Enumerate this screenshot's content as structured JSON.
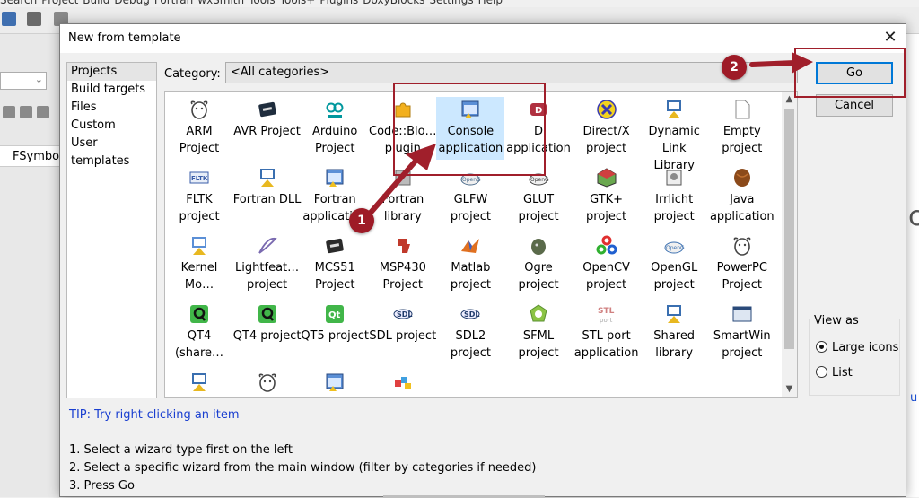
{
  "background": {
    "menu_items": [
      "Search",
      "Project",
      "Build",
      "Debug",
      "Fortran",
      "wxSmith",
      "Tools",
      "Tools+",
      "Plugins",
      "DoxyBlocks",
      "Settings",
      "Help"
    ],
    "left_tab_label": "FSymbo",
    "right_text": "c",
    "right_link": "u"
  },
  "dialog": {
    "title": "New from template",
    "close_glyph": "✕",
    "categories_nav": [
      "Projects",
      "Build targets",
      "Files",
      "Custom",
      "User templates"
    ],
    "selected_nav": "Projects",
    "category_label": "Category:",
    "category_value": "<All categories>",
    "tiles": [
      {
        "label": "ARM\nProject",
        "icon": "gnu-icon",
        "color": "#444444"
      },
      {
        "label": "AVR Project",
        "icon": "avr-chip-icon",
        "color": "#1f2d3d"
      },
      {
        "label": "Arduino\nProject",
        "icon": "arduino-icon",
        "color": "#00979d"
      },
      {
        "label": "Code::Blo…\nplugin",
        "icon": "puzzle-plugin-icon",
        "color": "#f2b01e"
      },
      {
        "label": "Console\napplication",
        "icon": "console-app-icon",
        "color": "#5b8fd6",
        "selected": true
      },
      {
        "label": "D\napplication",
        "icon": "d-lang-icon",
        "color": "#b03040"
      },
      {
        "label": "Direct/X\nproject",
        "icon": "directx-icon",
        "color": "#f2d21e"
      },
      {
        "label": "Dynamic\nLink Library",
        "icon": "dll-icon",
        "color": "#3a6fb0"
      },
      {
        "label": "Empty\nproject",
        "icon": "empty-file-icon",
        "color": "#ffffff"
      },
      {
        "label": "FLTK\nproject",
        "icon": "fltk-icon",
        "color": "#3a5da8"
      },
      {
        "label": "Fortran DLL",
        "icon": "fortran-dll-icon",
        "color": "#3a6fb0"
      },
      {
        "label": "Fortran\napplication",
        "icon": "fortran-app-icon",
        "color": "#5b8fd6"
      },
      {
        "label": "Fortran\nlibrary",
        "icon": "fortran-lib-icon",
        "color": "#6a6a6a"
      },
      {
        "label": "GLFW\nproject",
        "icon": "glfw-icon",
        "color": "#4a6a8a"
      },
      {
        "label": "GLUT\nproject",
        "icon": "glut-icon",
        "color": "#3a3a3a"
      },
      {
        "label": "GTK+\nproject",
        "icon": "gtk-icon",
        "color": "#6aa84f"
      },
      {
        "label": "Irrlicht\nproject",
        "icon": "irrlicht-icon",
        "color": "#555555"
      },
      {
        "label": "Java\napplication",
        "icon": "java-icon",
        "color": "#8b4a1a"
      },
      {
        "label": "Kernel\nMo…",
        "icon": "kernel-module-icon",
        "color": "#5b8fd6"
      },
      {
        "label": "Lightfeat…\nproject",
        "icon": "lightfeather-icon",
        "color": "#7a6ab0"
      },
      {
        "label": "MCS51\nProject",
        "icon": "mcs51-chip-icon",
        "color": "#2a2a2a"
      },
      {
        "label": "MSP430\nProject",
        "icon": "ti-icon",
        "color": "#c0392b"
      },
      {
        "label": "Matlab\nproject",
        "icon": "matlab-icon",
        "color": "#e07020"
      },
      {
        "label": "Ogre\nproject",
        "icon": "ogre-icon",
        "color": "#5a6a4a"
      },
      {
        "label": "OpenCV\nproject",
        "icon": "opencv-icon",
        "color": "#2060d0"
      },
      {
        "label": "OpenGL\nproject",
        "icon": "opengl-icon",
        "color": "#3a6fb0"
      },
      {
        "label": "PowerPC\nProject",
        "icon": "gnu-icon",
        "color": "#444444"
      },
      {
        "label": "QT4\n(share…",
        "icon": "qt-q-icon",
        "color": "#41b649"
      },
      {
        "label": "QT4 project",
        "icon": "qt-q-icon",
        "color": "#41b649"
      },
      {
        "label": "QT5 project",
        "icon": "qt5-icon",
        "color": "#41b649"
      },
      {
        "label": "SDL project",
        "icon": "sdl-icon",
        "color": "#1f3a6a"
      },
      {
        "label": "SDL2\nproject",
        "icon": "sdl2-icon",
        "color": "#1f3a6a"
      },
      {
        "label": "SFML\nproject",
        "icon": "sfml-icon",
        "color": "#8cc445"
      },
      {
        "label": "STL port\napplication",
        "icon": "stlport-icon",
        "color": "#d08080"
      },
      {
        "label": "Shared\nlibrary",
        "icon": "shared-lib-icon",
        "color": "#3a6fb0"
      },
      {
        "label": "SmartWin\nproject",
        "icon": "smartwin-icon",
        "color": "#2a4a7a"
      },
      {
        "label": "",
        "icon": "lib-icon",
        "color": "#3a6fb0"
      },
      {
        "label": "",
        "icon": "gnu-icon",
        "color": "#444444"
      },
      {
        "label": "",
        "icon": "window-app-icon",
        "color": "#5b8fd6"
      },
      {
        "label": "",
        "icon": "blocks-icon",
        "color": "#e04040"
      }
    ],
    "go_label": "Go",
    "cancel_label": "Cancel",
    "view_as": {
      "title": "View as",
      "options": [
        "Large icons",
        "List"
      ],
      "selected": "Large icons"
    },
    "tip": "TIP: Try right-clicking an item",
    "instructions": [
      "1. Select a wizard type first on the left",
      "2. Select a specific wizard from the main window (filter by categories if needed)",
      "3. Press Go"
    ]
  },
  "annotations": {
    "step1": "1",
    "step2": "2",
    "color": "#a01f2b"
  }
}
